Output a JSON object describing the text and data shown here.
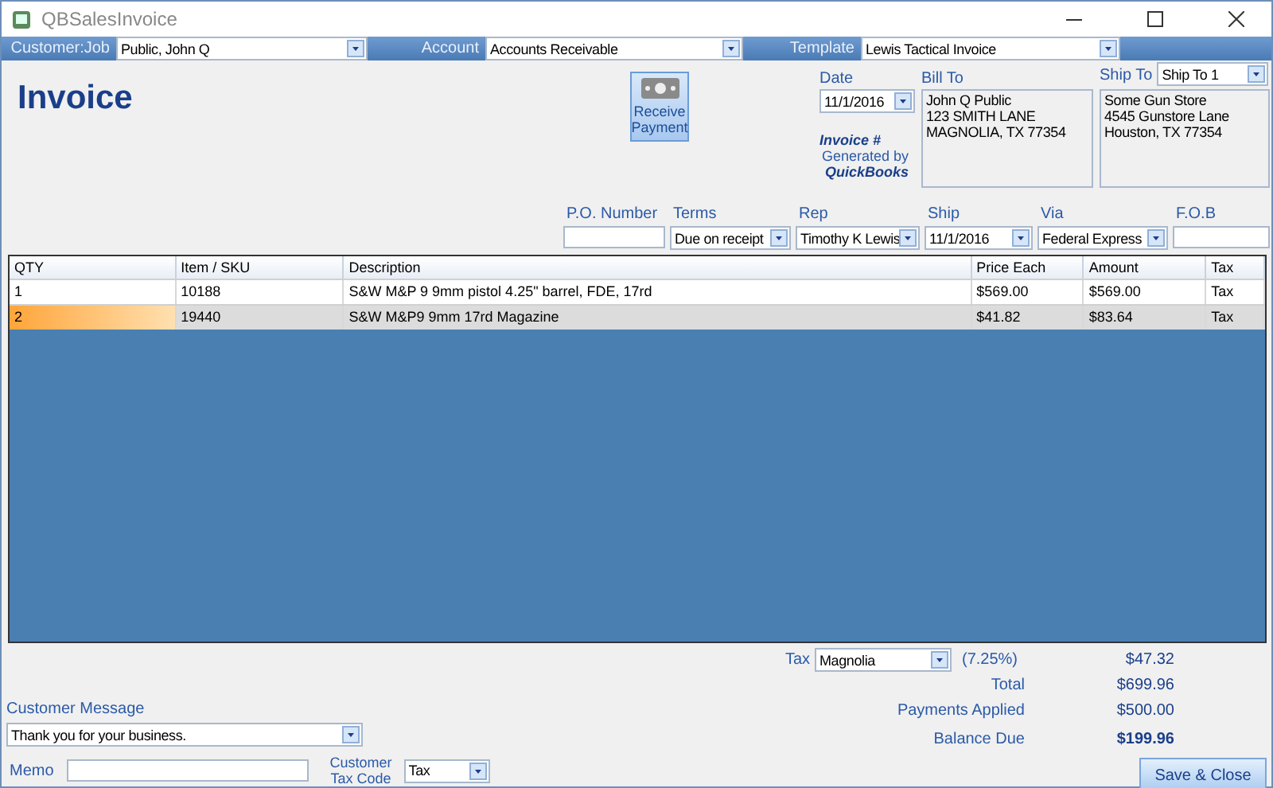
{
  "window": {
    "title": "QBSalesInvoice"
  },
  "toolbar": [
    {
      "label": "Customer:Job",
      "value": "Public, John Q"
    },
    {
      "label": "Account",
      "value": "Accounts Receivable"
    },
    {
      "label": "Template",
      "value": "Lewis Tactical Invoice"
    }
  ],
  "header": {
    "title": "Invoice",
    "receive_payment": "Receive Payment",
    "date": {
      "label": "Date",
      "value": "11/1/2016"
    },
    "invoice_number": "Invoice #",
    "generated_by": "Generated by",
    "brand": "QuickBooks",
    "bill_to": {
      "label": "Bill To",
      "lines": [
        "John Q Public",
        "123 SMITH LANE",
        "MAGNOLIA, TX 77354"
      ]
    },
    "ship_to": {
      "label": "Ship To",
      "value": "Ship To 1",
      "lines": [
        "Some Gun Store",
        "4545 Gunstore Lane",
        "Houston, TX 77354"
      ]
    }
  },
  "details": [
    {
      "label": "P.O. Number",
      "kind": "text"
    },
    {
      "label": "Terms",
      "value": "Due on receipt",
      "kind": "combo"
    },
    {
      "label": "Rep",
      "value": "Timothy K Lewis",
      "kind": "combo"
    },
    {
      "label": "Ship",
      "value": "11/1/2016",
      "kind": "combo"
    },
    {
      "label": "Via",
      "value": "Federal Express",
      "kind": "combo"
    },
    {
      "label": "F.O.B",
      "kind": "text"
    }
  ],
  "table": {
    "columns": [
      "QTY",
      "Item / SKU",
      "Description",
      "Price Each",
      "Amount",
      "Tax"
    ],
    "rows": [
      {
        "cells": [
          "1",
          "10188",
          "S&W M&P 9 9mm pistol 4.25\" barrel, FDE, 17rd",
          "$569.00",
          "$569.00",
          "Tax"
        ],
        "selected": false
      },
      {
        "cells": [
          "2",
          "19440",
          "S&W M&P9 9mm 17rd Magazine",
          "$41.82",
          "$83.64",
          "Tax"
        ],
        "selected": true
      }
    ]
  },
  "tax": {
    "label": "Tax",
    "value": "Magnolia",
    "rate": "(7.25%)",
    "amount": "$47.32"
  },
  "totals": [
    {
      "label": "Total",
      "value": "$699.96",
      "bold": false
    },
    {
      "label": "Payments Applied",
      "value": "$500.00",
      "bold": false
    },
    {
      "label": "Balance Due",
      "value": "$199.96",
      "bold": true
    }
  ],
  "customer_message": {
    "label": "Customer Message",
    "value": "Thank you for your business."
  },
  "memo": {
    "label": "Memo"
  },
  "tax_code": {
    "label": "Customer Tax Code",
    "value": "Tax"
  },
  "save_button": "Save & Close"
}
